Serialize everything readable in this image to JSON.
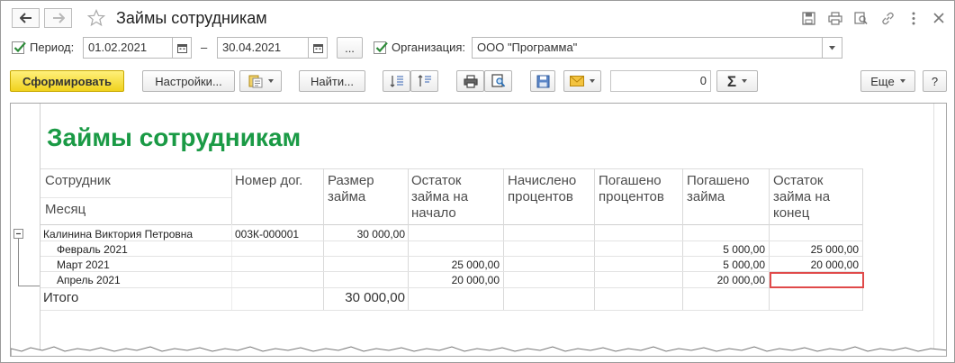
{
  "window": {
    "title": "Займы сотрудникам",
    "star_icon": "star-icon",
    "toolbar_icons": [
      "save-icon",
      "print-icon",
      "preview-icon",
      "link-icon",
      "more-icon",
      "close-icon"
    ]
  },
  "filters": {
    "period_label": "Период:",
    "date_from": "01.02.2021",
    "dash": "–",
    "date_to": "30.04.2021",
    "choose_label": "...",
    "org_label": "Организация:",
    "org_value": "ООО \"Программа\""
  },
  "toolbar": {
    "generate_label": "Сформировать",
    "settings_label": "Настройки...",
    "find_label": "Найти...",
    "sum_value": "0",
    "more_label": "Еще",
    "help_label": "?"
  },
  "report": {
    "title": "Займы сотрудникам",
    "headers": {
      "employee": "Сотрудник",
      "month": "Месяц",
      "contract": "Номер дог.",
      "loan_size": [
        "Размер",
        "займа"
      ],
      "balance_start": [
        "Остаток",
        "займа на",
        "начало"
      ],
      "interest_accrued": [
        "Начислено",
        "процентов"
      ],
      "interest_paid": [
        "Погашено",
        "процентов"
      ],
      "loan_paid": [
        "Погашено",
        "займа"
      ],
      "balance_end": [
        "Остаток",
        "займа на",
        "конец"
      ]
    },
    "rows": [
      {
        "name": "Калинина Виктория Петровна",
        "contract": "003К-000001",
        "loan_size": "30 000,00",
        "balance_start": "",
        "loan_paid": "",
        "balance_end": ""
      },
      {
        "name": "Февраль 2021",
        "contract": "",
        "loan_size": "",
        "balance_start": "",
        "loan_paid": "5 000,00",
        "balance_end": "25 000,00"
      },
      {
        "name": "Март 2021",
        "contract": "",
        "loan_size": "",
        "balance_start": "25 000,00",
        "loan_paid": "5 000,00",
        "balance_end": "20 000,00"
      },
      {
        "name": "Апрель 2021",
        "contract": "",
        "loan_size": "",
        "balance_start": "20 000,00",
        "loan_paid": "20 000,00",
        "balance_end": ""
      }
    ],
    "total": {
      "label": "Итого",
      "loan_size": "30 000,00"
    }
  },
  "colors": {
    "accent_green": "#1a9a45",
    "button_yellow": "#f5dc2e",
    "selected_cell": "#e04a4a"
  }
}
